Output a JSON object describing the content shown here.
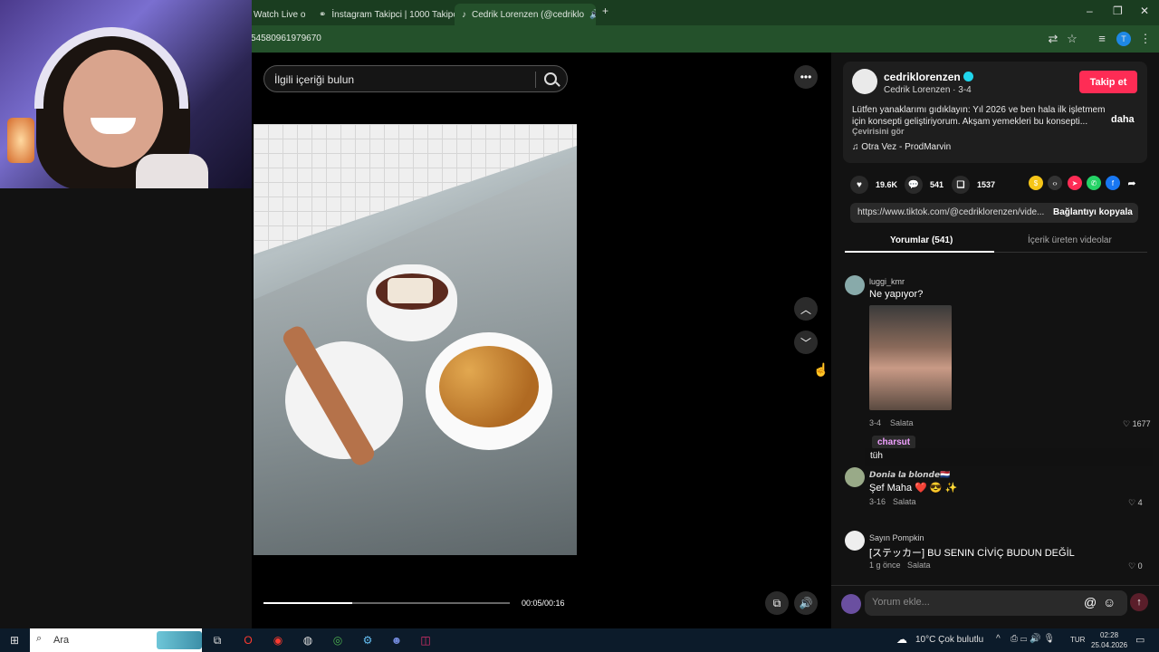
{
  "browser": {
    "tabs": [
      {
        "label": "Watch Live o",
        "active": false
      },
      {
        "label": "İnstagram Takipci | 1000 Takipç",
        "active": false
      },
      {
        "label": "Cedrik Lorenzen (@cedriklo",
        "active": true
      }
    ],
    "url": "54580961979670"
  },
  "search": {
    "placeholder": "İlgili içeriği bulun"
  },
  "video": {
    "timecode": "00:05/00:16",
    "progress": 0.36
  },
  "creator": {
    "username": "cedriklorenzen",
    "subline": "Cedrik Lorenzen · 3-4",
    "follow_label": "Takip et",
    "caption": "Lütfen yanaklarımı gıdıklayın: Yıl 2026 ve ben hala ilk işletmem için konsepti geliştiriyorum. Akşam yemekleri bu konsepti...",
    "more_label": "daha",
    "translate_label": "Çevirisini gör",
    "music": "♫  Otra Vez - ProdMarvin"
  },
  "stats": {
    "likes": "19.6K",
    "comments": "541",
    "saves": "1537"
  },
  "share_icons": [
    "coin-icon",
    "embed-icon",
    "send-icon",
    "whatsapp-icon",
    "facebook-icon",
    "share-arrow-icon"
  ],
  "link": {
    "url": "https://www.tiktok.com/@cedriklorenzen/vide...",
    "copy_label": "Bağlantıyı kopyala"
  },
  "tabs": {
    "comments": "Yorumlar (541)",
    "creator_videos": "İçerik üreten videolar"
  },
  "comments": [
    {
      "user": "luggi_kmr",
      "text": "Ne yapıyor?",
      "date": "3-4",
      "reply": "Salata",
      "likes": "1677"
    },
    {
      "user": "𝘿𝙤𝙣𝙞𝙖 𝙡𝙖 𝙗𝙡𝙤𝙣𝙙𝙚🇳🇱",
      "text": "Şef Maha ❤️ 😎 ✨",
      "date": "3-16",
      "reply": "Salata",
      "likes": "4"
    },
    {
      "user": "Sayın Pompkin",
      "text": "[ステッカー] BU SENIN CİVİÇ BUDUN DEĞİL",
      "date": "1 g önce",
      "reply": "Salata",
      "likes": "0"
    }
  ],
  "tooltip": {
    "user": "charsut",
    "text": "tüh"
  },
  "comment_input": {
    "placeholder": "Yorum ekle..."
  },
  "taskbar": {
    "search_label": "Ara",
    "weather": "10°C  Çok bulutlu",
    "lang": "TUR",
    "time": "02:28",
    "date": "25.04.2026"
  }
}
